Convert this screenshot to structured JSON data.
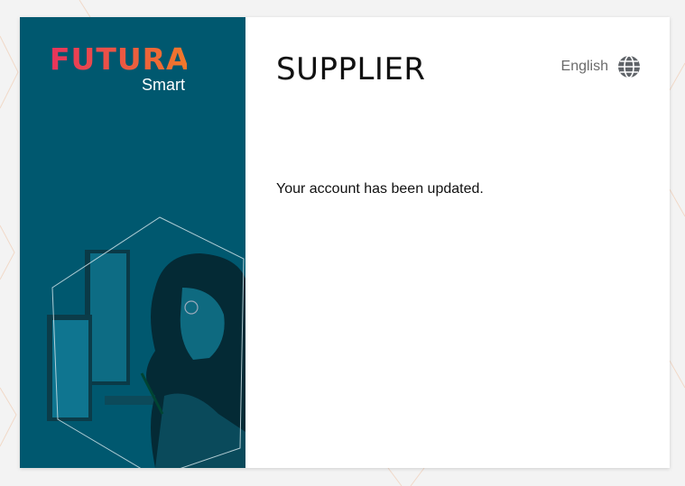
{
  "brand": {
    "name": "FUTURA",
    "sub": "Smart"
  },
  "portal_title": "SUPPLIER",
  "language": {
    "label": "English",
    "icon": "globe-icon"
  },
  "message": "Your account has been updated.",
  "colors": {
    "side_panel": "#00586f",
    "brand_gradient_start": "#e8345c",
    "brand_gradient_end": "#f07a2a",
    "text_muted": "#6b6b6b"
  }
}
